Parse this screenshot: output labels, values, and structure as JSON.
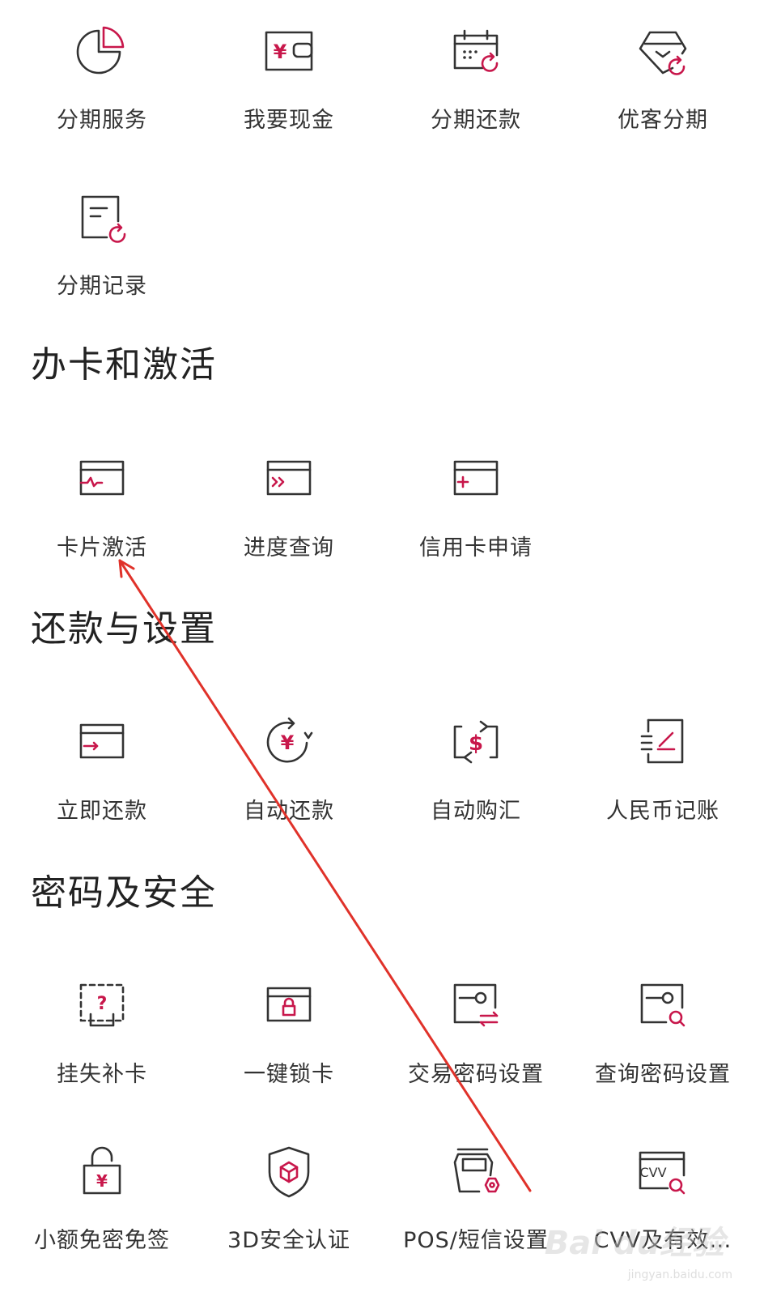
{
  "colors": {
    "accent": "#c8174b",
    "icon_stroke": "#333333",
    "annotation_arrow": "#e0322a"
  },
  "top_group": {
    "items": [
      {
        "label": "分期服务",
        "icon": "pie-chart-icon"
      },
      {
        "label": "我要现金",
        "icon": "wallet-yuan-icon"
      },
      {
        "label": "分期还款",
        "icon": "calendar-refresh-icon"
      },
      {
        "label": "优客分期",
        "icon": "diamond-refresh-icon"
      },
      {
        "label": "分期记录",
        "icon": "document-refresh-icon"
      }
    ]
  },
  "sections": [
    {
      "title": "办卡和激活",
      "items": [
        {
          "label": "卡片激活",
          "icon": "card-pulse-icon"
        },
        {
          "label": "进度查询",
          "icon": "card-forward-icon"
        },
        {
          "label": "信用卡申请",
          "icon": "card-plus-icon"
        }
      ]
    },
    {
      "title": "还款与设置",
      "items": [
        {
          "label": "立即还款",
          "icon": "card-arrow-icon"
        },
        {
          "label": "自动还款",
          "icon": "yuan-cycle-icon"
        },
        {
          "label": "自动购汇",
          "icon": "dollar-exchange-icon"
        },
        {
          "label": "人民币记账",
          "icon": "ledger-pen-icon"
        }
      ]
    },
    {
      "title": "密码及安全",
      "items": [
        {
          "label": "挂失补卡",
          "icon": "card-question-icon"
        },
        {
          "label": "一键锁卡",
          "icon": "card-lock-icon"
        },
        {
          "label": "交易密码设置",
          "icon": "key-exchange-icon"
        },
        {
          "label": "查询密码设置",
          "icon": "key-search-icon"
        },
        {
          "label": "小额免密免签",
          "icon": "padlock-yuan-icon"
        },
        {
          "label": "3D安全认证",
          "icon": "shield-cube-icon"
        },
        {
          "label": "POS/短信设置",
          "icon": "pos-terminal-icon"
        },
        {
          "label": "CVV及有效…",
          "icon": "cvv-search-icon"
        }
      ]
    }
  ],
  "icon_glyphs": {
    "yuan": "¥",
    "dollar": "$",
    "question": "?",
    "cvv": "CVV"
  },
  "watermark": {
    "brand": "Bai du经验",
    "sub": "jingyan.baidu.com"
  }
}
